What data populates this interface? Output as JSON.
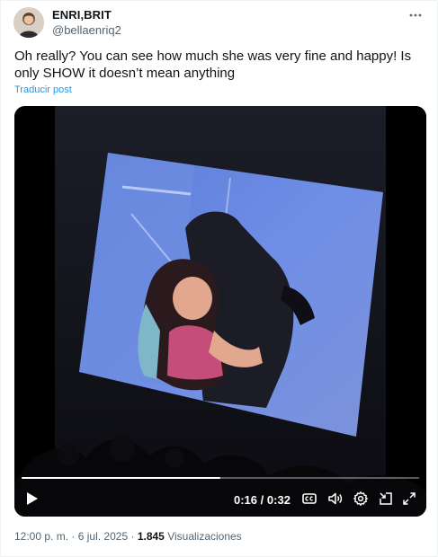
{
  "author": {
    "display_name": "ENRI,BRIT",
    "handle": "@bellaenriq2"
  },
  "tweet": {
    "text": "Oh really? You can see how much she was very fine and happy! Is only SHOW it doesn’t mean anything",
    "translate_label": "Traducir post"
  },
  "video": {
    "current_time": "0:16",
    "separator": "/",
    "duration": "0:32",
    "progress_fraction": 0.5
  },
  "meta": {
    "time": "12:00 p. m.",
    "dot1": "·",
    "date": "6 jul. 2025",
    "dot2": "·",
    "views_count": "1.845",
    "views_label": "Visualizaciones"
  },
  "icons": {
    "more": "more-horizontal-icon",
    "play": "play-icon",
    "captions": "captions-icon",
    "volume": "volume-icon",
    "settings": "gear-icon",
    "pip": "picture-in-picture-icon",
    "fullscreen": "fullscreen-icon"
  },
  "colors": {
    "link": "#1d9bf0",
    "secondary_text": "#536471",
    "primary_text": "#0f1419"
  }
}
